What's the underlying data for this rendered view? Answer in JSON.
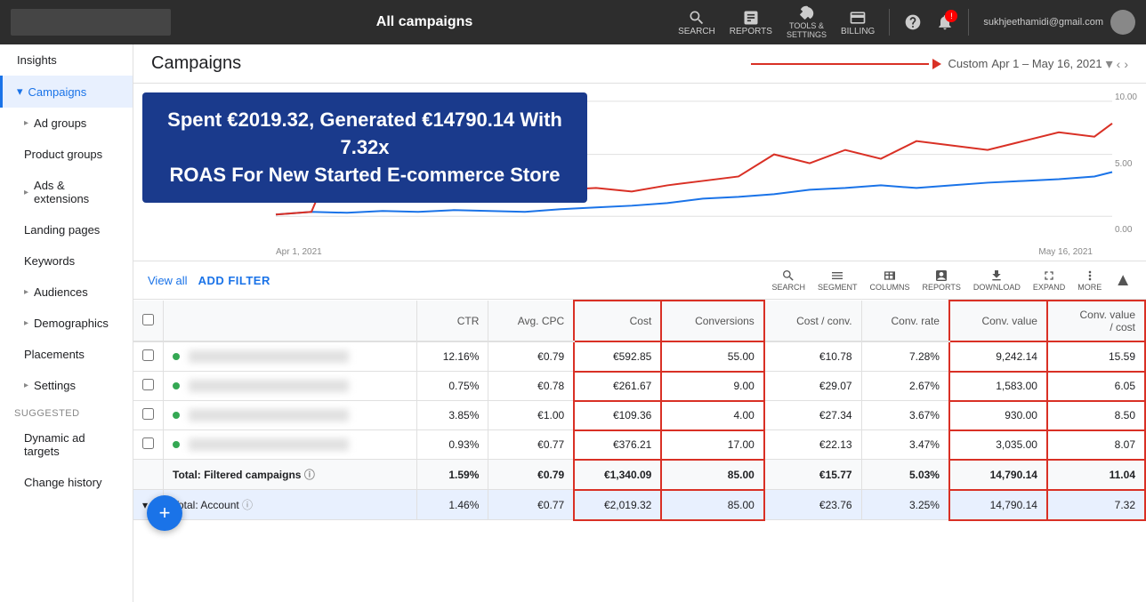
{
  "topNav": {
    "pageTitle": "All campaigns",
    "userEmail": "sukhjeethamidi@gmail.com",
    "icons": [
      {
        "name": "search-icon",
        "label": "SEARCH"
      },
      {
        "name": "reports-icon",
        "label": "REPORTS"
      },
      {
        "name": "tools-icon",
        "label": "TOOLS &\nSETTINGS"
      },
      {
        "name": "billing-icon",
        "label": "BILLING"
      }
    ]
  },
  "sidebar": {
    "topItem": "Insights",
    "items": [
      {
        "label": "Ad groups",
        "arrow": true,
        "active": false
      },
      {
        "label": "Product groups",
        "arrow": false,
        "active": false
      },
      {
        "label": "Ads & extensions",
        "arrow": true,
        "active": false
      },
      {
        "label": "Landing pages",
        "arrow": false,
        "active": false
      },
      {
        "label": "Keywords",
        "arrow": false,
        "active": false
      },
      {
        "label": "Audiences",
        "arrow": true,
        "active": false
      },
      {
        "label": "Demographics",
        "arrow": true,
        "active": false
      },
      {
        "label": "Placements",
        "arrow": false,
        "active": false
      },
      {
        "label": "Settings",
        "arrow": true,
        "active": false
      }
    ],
    "suggested": "Suggested",
    "suggestedItems": [
      {
        "label": "Dynamic ad targets",
        "arrow": false
      },
      {
        "label": "Change history",
        "arrow": false
      }
    ]
  },
  "campaignsHeader": {
    "title": "Campaigns",
    "dateLabel": "Custom",
    "dateRange": "Apr 1 – May 16, 2021"
  },
  "banner": {
    "line1": "Spent €2019.32, Generated €14790.14  With 7.32x",
    "line2": "ROAS For New Started E-commerce Store"
  },
  "chart": {
    "yAxisRight": [
      "10.00",
      "5.00",
      "0.00"
    ],
    "xStart": "Apr 1, 2021",
    "xEnd": "May 16, 2021"
  },
  "tableToolbar": {
    "viewAll": "View all",
    "addFilter": "ADD FILTER",
    "icons": [
      {
        "name": "search-icon",
        "label": "SEARCH"
      },
      {
        "name": "segment-icon",
        "label": "SEGMENT"
      },
      {
        "name": "columns-icon",
        "label": "COLUMNS"
      },
      {
        "name": "reports-icon",
        "label": "REPORTS"
      },
      {
        "name": "download-icon",
        "label": "DOWNLOAD"
      },
      {
        "name": "expand-icon",
        "label": "EXPAND"
      },
      {
        "name": "more-icon",
        "label": "MORE"
      }
    ]
  },
  "table": {
    "columns": [
      {
        "key": "checkbox",
        "label": ""
      },
      {
        "key": "name",
        "label": ""
      },
      {
        "key": "ctr",
        "label": "CTR"
      },
      {
        "key": "avgCpc",
        "label": "Avg. CPC"
      },
      {
        "key": "cost",
        "label": "Cost",
        "highlight": true
      },
      {
        "key": "conversions",
        "label": "Conversions",
        "highlight": true
      },
      {
        "key": "costPerConv",
        "label": "Cost / conv."
      },
      {
        "key": "convRate",
        "label": "Conv. rate"
      },
      {
        "key": "convValue",
        "label": "Conv. value",
        "highlight2": true
      },
      {
        "key": "convValuePerCost",
        "label": "Conv. value / cost",
        "highlight2": true
      }
    ],
    "rows": [
      {
        "ctr": "12.16%",
        "avgCpc": "€0.79",
        "cost": "€592.85",
        "conversions": "55.00",
        "costPerConv": "€10.78",
        "convRate": "7.28%",
        "convValue": "9,242.14",
        "convValuePerCost": "15.59"
      },
      {
        "ctr": "0.75%",
        "avgCpc": "€0.78",
        "cost": "€261.67",
        "conversions": "9.00",
        "costPerConv": "€29.07",
        "convRate": "2.67%",
        "convValue": "1,583.00",
        "convValuePerCost": "6.05"
      },
      {
        "ctr": "3.85%",
        "avgCpc": "€1.00",
        "cost": "€109.36",
        "conversions": "4.00",
        "costPerConv": "€27.34",
        "convRate": "3.67%",
        "convValue": "930.00",
        "convValuePerCost": "8.50"
      },
      {
        "ctr": "0.93%",
        "avgCpc": "€0.77",
        "cost": "€376.21",
        "conversions": "17.00",
        "costPerConv": "€22.13",
        "convRate": "3.47%",
        "convValue": "3,035.00",
        "convValuePerCost": "8.07"
      }
    ],
    "totalFiltered": {
      "label": "Total: Filtered campaigns",
      "ctr": "1.59%",
      "avgCpc": "€0.79",
      "cost": "€1,340.09",
      "conversions": "85.00",
      "costPerConv": "€15.77",
      "convRate": "5.03%",
      "convValue": "14,790.14",
      "convValuePerCost": "11.04"
    },
    "totalAccount": {
      "label": "Total: Account",
      "ctr": "1.46%",
      "avgCpc": "€0.77",
      "cost": "€2,019.32",
      "conversions": "85.00",
      "costPerConv": "€23.76",
      "convRate": "3.25%",
      "convValue": "14,790.14",
      "convValuePerCost": "7.32"
    }
  },
  "fab": {
    "label": "+"
  }
}
